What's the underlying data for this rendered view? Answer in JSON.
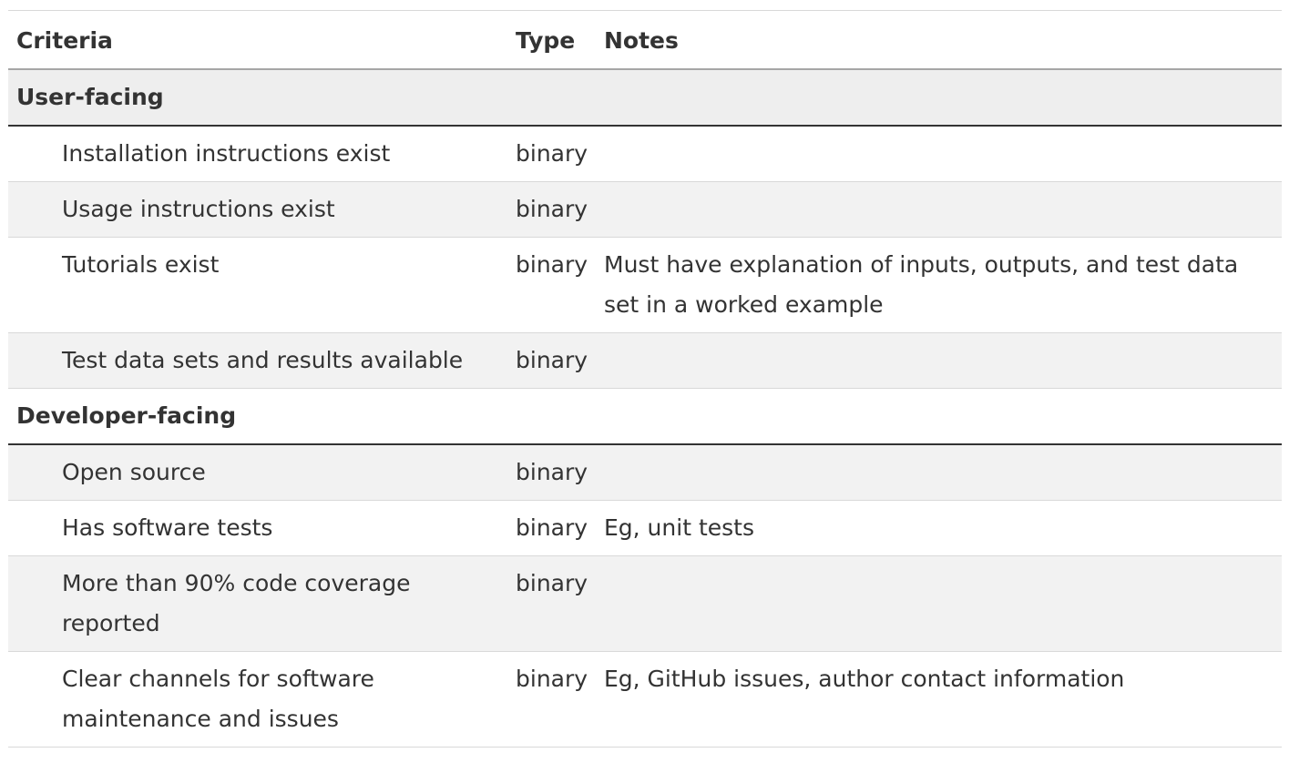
{
  "table": {
    "headers": {
      "criteria": "Criteria",
      "type": "Type",
      "notes": "Notes"
    },
    "groups": [
      {
        "label": "User-facing",
        "rows": [
          {
            "criteria": "Installation instructions exist",
            "type": "binary",
            "notes": ""
          },
          {
            "criteria": "Usage instructions exist",
            "type": "binary",
            "notes": ""
          },
          {
            "criteria": "Tutorials exist",
            "type": "binary",
            "notes": "Must have explanation of inputs, outputs, and test data set in a worked example"
          },
          {
            "criteria": "Test data sets and results available",
            "type": "binary",
            "notes": ""
          }
        ]
      },
      {
        "label": "Developer-facing",
        "rows": [
          {
            "criteria": "Open source",
            "type": "binary",
            "notes": ""
          },
          {
            "criteria": "Has software tests",
            "type": "binary",
            "notes": "Eg, unit tests"
          },
          {
            "criteria": "More than 90% code coverage reported",
            "type": "binary",
            "notes": ""
          },
          {
            "criteria": "Clear channels for software maintenance and issues",
            "type": "binary",
            "notes": "Eg, GitHub issues, author contact information"
          }
        ]
      }
    ]
  }
}
